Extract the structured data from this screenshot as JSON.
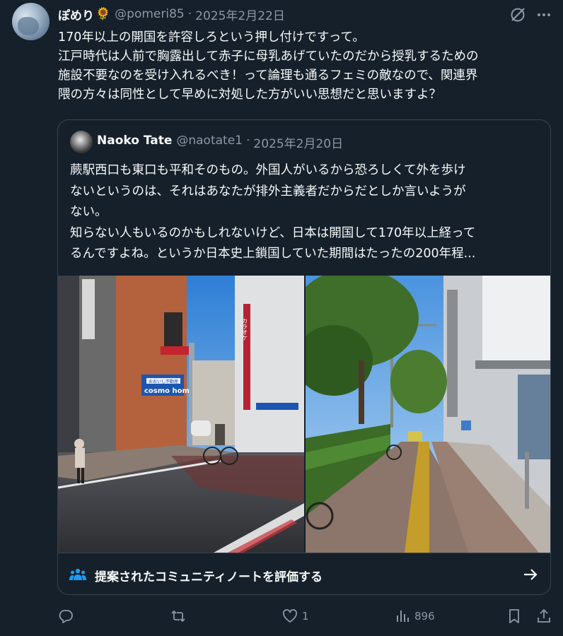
{
  "tweet": {
    "name": "ぽめり",
    "name_emoji": "🌻",
    "handle": "@pomeri85",
    "date": "2025年2月22日",
    "lines": [
      "170年以上の開国を許容しろという押し付けですって。",
      "江戸時代は人前で胸露出して赤子に母乳あげていたのだから授乳するための",
      "施設不要なのを受け入れるべき！って論理も通るフェミの敵なので、関連界",
      "隈の方々は同性として早めに対処した方がいい思想だと思いますよ？"
    ]
  },
  "quote": {
    "name": "Naoko Tate",
    "handle": "@naotate1",
    "date": "2025年2月20日",
    "lines": [
      "蕨駅西口も東口も平和そのもの。外国人がいるから恐ろしくて外を歩け",
      "ないというのは、それはあなたが排外主義者だからだとしか言いようが",
      "ない。",
      "知らない人もいるのかもしれないけど、日本は開国して170年以上経って",
      "るんですよね。というか日本史上鎖国していた期間はたったの200年程..."
    ],
    "photo_left_signs": {
      "cosmo_small": "おおいし不動産",
      "cosmo_big": "cosmo home",
      "karaoke": "カラオケ"
    },
    "community_note": "提案されたコミュニティノートを評価する"
  },
  "actions": {
    "likes": "1",
    "views": "896"
  },
  "colors": {
    "background": "#15202b",
    "text": "#f7f9f9",
    "muted": "#8b98a5",
    "border": "#38444d",
    "note_blue": "#1d9bf0"
  },
  "icons": [
    "grok-icon",
    "more-icon",
    "community-note-icon",
    "arrow-right-icon",
    "reply-icon",
    "repost-icon",
    "like-icon",
    "views-icon",
    "bookmark-icon",
    "share-icon"
  ]
}
